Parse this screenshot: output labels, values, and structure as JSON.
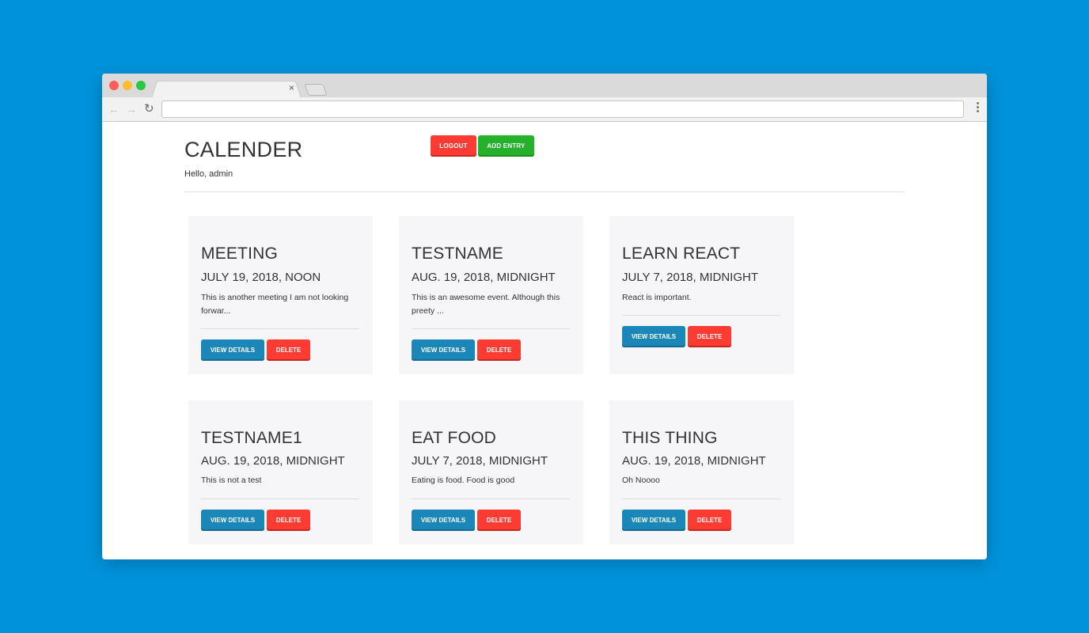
{
  "browser": {
    "tab_close": "×",
    "address_value": ""
  },
  "header": {
    "title": "CALENDER",
    "greeting": "Hello, admin",
    "logout_label": "LOGOUT",
    "add_entry_label": "ADD ENTRY"
  },
  "cards": [
    {
      "title": "MEETING",
      "date": "JULY 19, 2018, NOON",
      "description": "This is another meeting I am not looking forwar...",
      "view_label": "VIEW DETAILS",
      "delete_label": "DELETE"
    },
    {
      "title": "TESTNAME",
      "date": "AUG. 19, 2018, MIDNIGHT",
      "description": "This is an awesome event. Although this preety ...",
      "view_label": "VIEW DETAILS",
      "delete_label": "DELETE"
    },
    {
      "title": "LEARN REACT",
      "date": "JULY 7, 2018, MIDNIGHT",
      "description": "React is important.",
      "view_label": "VIEW DETAILS",
      "delete_label": "DELETE"
    },
    {
      "title": "TESTNAME1",
      "date": "AUG. 19, 2018, MIDNIGHT",
      "description": "This is not a test",
      "view_label": "VIEW DETAILS",
      "delete_label": "DELETE"
    },
    {
      "title": "EAT FOOD",
      "date": "JULY 7, 2018, MIDNIGHT",
      "description": "Eating is food. Food is good",
      "view_label": "VIEW DETAILS",
      "delete_label": "DELETE"
    },
    {
      "title": "THIS THING",
      "date": "AUG. 19, 2018, MIDNIGHT",
      "description": "Oh Noooo",
      "view_label": "VIEW DETAILS",
      "delete_label": "DELETE"
    }
  ],
  "colors": {
    "background": "#0093dc",
    "logout": "#fc3b33",
    "add_entry": "#25b12a",
    "view_details": "#1a87b8",
    "delete": "#fc3b33"
  }
}
